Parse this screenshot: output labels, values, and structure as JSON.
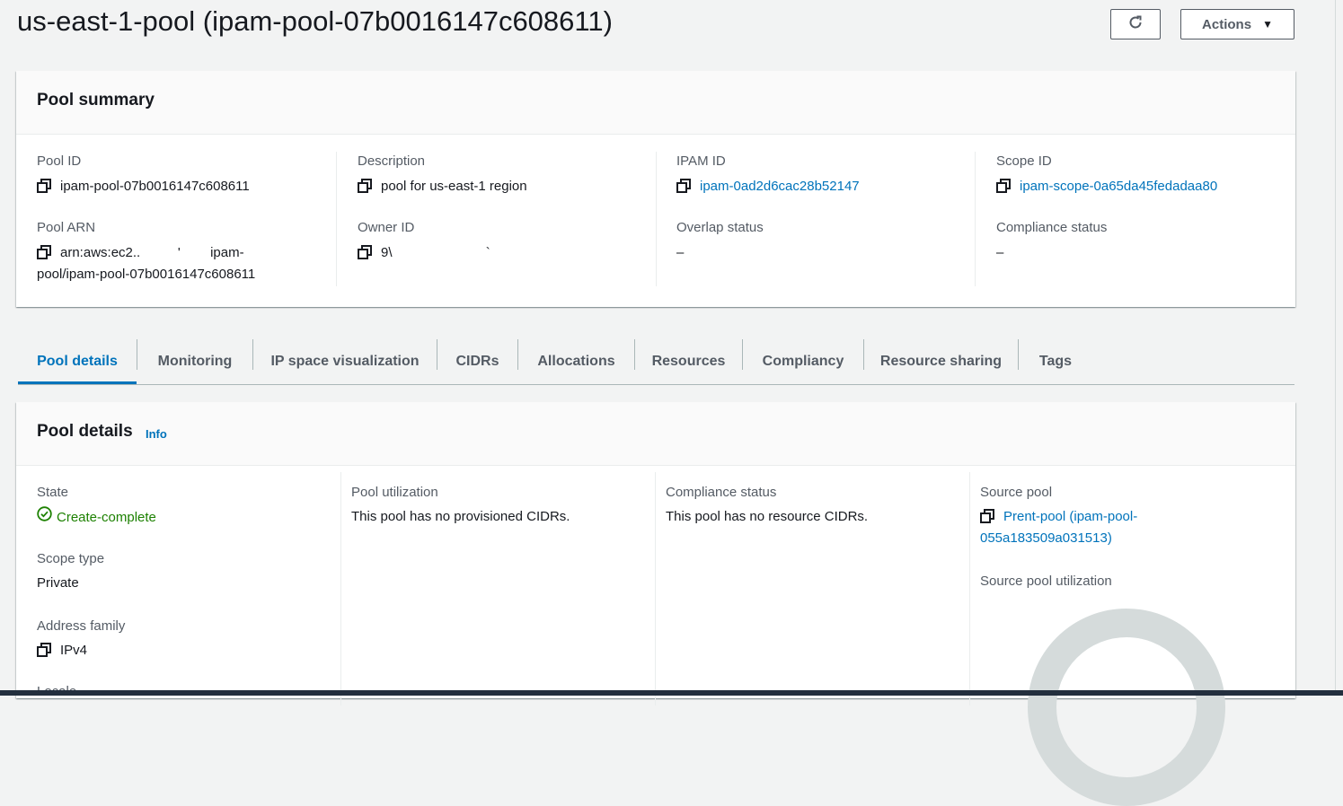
{
  "page": {
    "title": "us-east-1-pool (ipam-pool-07b0016147c608611)",
    "refresh_icon": "refresh-icon",
    "actions_label": "Actions",
    "actions_caret": "▼"
  },
  "summary": {
    "title": "Pool summary",
    "pool_id_label": "Pool ID",
    "pool_id": "ipam-pool-07b0016147c608611",
    "pool_arn_label": "Pool ARN",
    "pool_arn_line1": "arn:aws:ec2..          '        ipam-",
    "pool_arn_line2": "pool/ipam-pool-07b0016147c608611",
    "description_label": "Description",
    "description": "pool for us-east-1 region",
    "owner_id_label": "Owner ID",
    "owner_id": "9\\                         `",
    "ipam_id_label": "IPAM ID",
    "ipam_id": "ipam-0ad2d6cac28b52147",
    "overlap_label": "Overlap status",
    "overlap_value": "–",
    "scope_id_label": "Scope ID",
    "scope_id": "ipam-scope-0a65da45fedadaa80",
    "compliance_label": "Compliance status",
    "compliance_value": "–"
  },
  "tabs": [
    {
      "label": "Pool details",
      "active": true
    },
    {
      "label": "Monitoring"
    },
    {
      "label": "IP space visualization"
    },
    {
      "label": "CIDRs"
    },
    {
      "label": "Allocations"
    },
    {
      "label": "Resources"
    },
    {
      "label": "Compliancy"
    },
    {
      "label": "Resource sharing"
    },
    {
      "label": "Tags"
    }
  ],
  "details": {
    "title": "Pool details",
    "info_label": "Info",
    "state_label": "State",
    "state_value": "Create-complete",
    "scope_type_label": "Scope type",
    "scope_type_value": "Private",
    "address_family_label": "Address family",
    "address_family_value": "IPv4",
    "locale_label": "Locale",
    "utilization_label": "Pool utilization",
    "utilization_value": "This pool has no provisioned CIDRs.",
    "compliance_label": "Compliance status",
    "compliance_value": "This pool has no resource CIDRs.",
    "source_pool_label": "Source pool",
    "source_pool_line1": "Prent-pool (ipam-pool-",
    "source_pool_line2": "055a183509a031513)",
    "source_util_label": "Source pool utilization"
  },
  "colors": {
    "link": "#0073bb",
    "success": "#1d8102",
    "donut_track": "#d5dbdb"
  }
}
